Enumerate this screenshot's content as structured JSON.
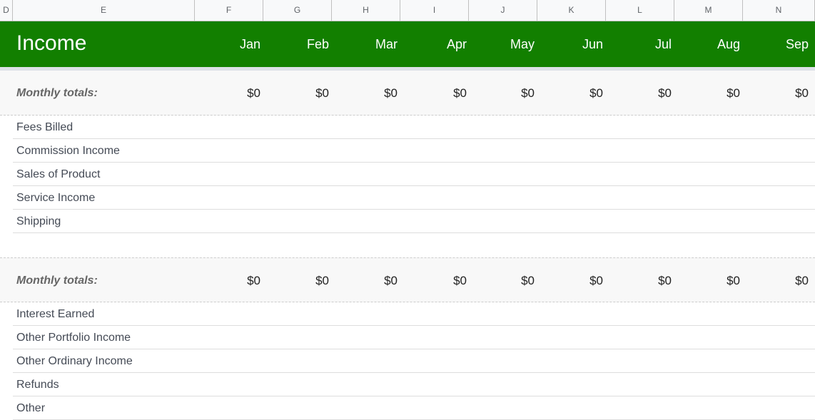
{
  "column_headers": [
    "D",
    "E",
    "F",
    "G",
    "H",
    "I",
    "J",
    "K",
    "L",
    "M",
    "N"
  ],
  "banner": {
    "title": "Income",
    "months": [
      "Jan",
      "Feb",
      "Mar",
      "Apr",
      "May",
      "Jun",
      "Jul",
      "Aug",
      "Sep"
    ],
    "color": "#127f00"
  },
  "sections": [
    {
      "totals_label": "Monthly totals:",
      "totals": [
        "$0",
        "$0",
        "$0",
        "$0",
        "$0",
        "$0",
        "$0",
        "$0",
        "$0"
      ],
      "items": [
        "Fees Billed",
        "Commission Income",
        "Sales of Product",
        "Service Income",
        "Shipping"
      ]
    },
    {
      "totals_label": "Monthly totals:",
      "totals": [
        "$0",
        "$0",
        "$0",
        "$0",
        "$0",
        "$0",
        "$0",
        "$0",
        "$0"
      ],
      "items": [
        "Interest Earned",
        "Other Portfolio Income",
        "Other Ordinary Income",
        "Refunds",
        "Other"
      ]
    }
  ]
}
